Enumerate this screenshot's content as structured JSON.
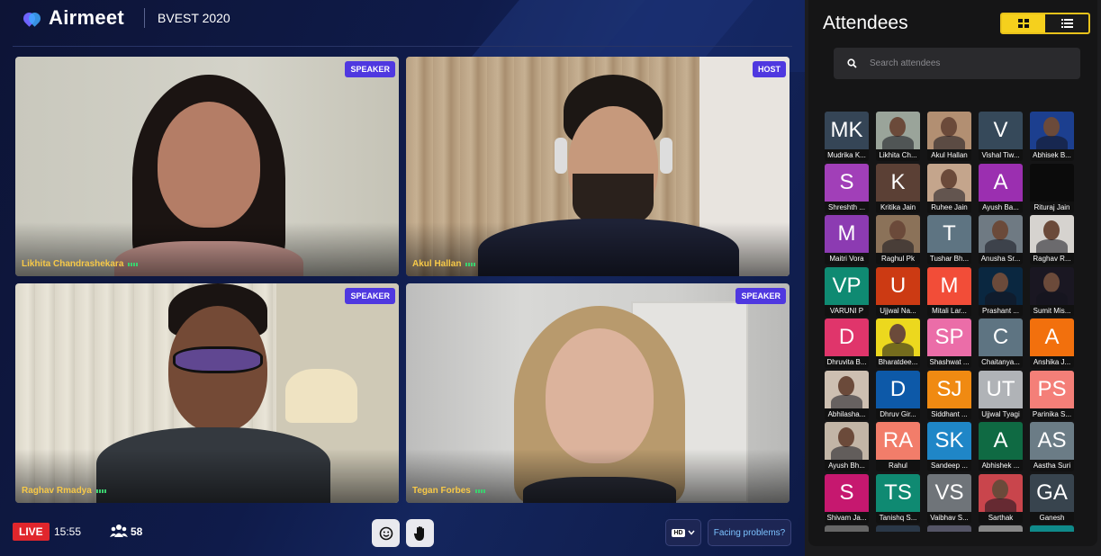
{
  "app": {
    "name": "Airmeet",
    "event": "BVEST 2020"
  },
  "speakers": [
    {
      "name": "Likhita Chandrashekara",
      "role": "SPEAKER"
    },
    {
      "name": "Akul Hallan",
      "role": "HOST"
    },
    {
      "name": "Raghav Rmadya",
      "role": "SPEAKER"
    },
    {
      "name": "Tegan Forbes",
      "role": "SPEAKER"
    }
  ],
  "bottom_bar": {
    "live_label": "LIVE",
    "time": "15:55",
    "participant_count": "58",
    "quality_label": "HD",
    "problems_label": "Facing problems?"
  },
  "attendees_panel": {
    "title": "Attendees",
    "search_placeholder": "Search attendees",
    "attendees": [
      {
        "initials": "MK",
        "name": "Mudrika K...",
        "color": "#354556",
        "photo": false
      },
      {
        "initials": "",
        "name": "Likhita Ch...",
        "color": "#9aa49a",
        "photo": true
      },
      {
        "initials": "",
        "name": "Akul Hallan",
        "color": "#b28f72",
        "photo": true
      },
      {
        "initials": "V",
        "name": "Vishal Tiw...",
        "color": "#36495a",
        "photo": false
      },
      {
        "initials": "",
        "name": "Abhisek B...",
        "color": "#1c3f8f",
        "photo": true
      },
      {
        "initials": "S",
        "name": "Shreshth ...",
        "color": "#a13fb8",
        "photo": false
      },
      {
        "initials": "K",
        "name": "Kritika Jain",
        "color": "#5b4035",
        "photo": false
      },
      {
        "initials": "",
        "name": "Ruhee Jain",
        "color": "#c4a58c",
        "photo": true
      },
      {
        "initials": "A",
        "name": "Ayush Ba...",
        "color": "#9b2fb0",
        "photo": false
      },
      {
        "initials": "",
        "name": "Rituraj Jain",
        "color": "#0b0b0b",
        "photo": false
      },
      {
        "initials": "M",
        "name": "Maitri Vora",
        "color": "#8c3bb2",
        "photo": false
      },
      {
        "initials": "",
        "name": "Raghul Pk",
        "color": "#8b7259",
        "photo": true
      },
      {
        "initials": "T",
        "name": "Tushar Bh...",
        "color": "#5e7482",
        "photo": false
      },
      {
        "initials": "",
        "name": "Anusha Sr...",
        "color": "#6f7a83",
        "photo": true
      },
      {
        "initials": "",
        "name": "Raghav R...",
        "color": "#d6d3cf",
        "photo": true
      },
      {
        "initials": "VP",
        "name": "VARUNI P",
        "color": "#0f8a72",
        "photo": false
      },
      {
        "initials": "U",
        "name": "Ujjwal Na...",
        "color": "#cc3a13",
        "photo": false
      },
      {
        "initials": "M",
        "name": "Mitali Lar...",
        "color": "#f24d38",
        "photo": false
      },
      {
        "initials": "",
        "name": "Prashant ...",
        "color": "#0a2740",
        "photo": true
      },
      {
        "initials": "",
        "name": "Sumit Mis...",
        "color": "#1a1722",
        "photo": true
      },
      {
        "initials": "D",
        "name": "Dhruvita B...",
        "color": "#e0356b",
        "photo": false
      },
      {
        "initials": "",
        "name": "Bharatdee...",
        "color": "#ecd81e",
        "photo": true
      },
      {
        "initials": "SP",
        "name": "Shashwat ...",
        "color": "#eb6da8",
        "photo": false
      },
      {
        "initials": "C",
        "name": "Chaitanya...",
        "color": "#5e7482",
        "photo": false
      },
      {
        "initials": "A",
        "name": "Anshika J...",
        "color": "#f2700d",
        "photo": false
      },
      {
        "initials": "",
        "name": "Abhilasha...",
        "color": "#cdbfb1",
        "photo": true
      },
      {
        "initials": "D",
        "name": "Dhruv Gir...",
        "color": "#0d59a8",
        "photo": false
      },
      {
        "initials": "SJ",
        "name": "Siddhant ...",
        "color": "#f08a12",
        "photo": false
      },
      {
        "initials": "UT",
        "name": "Ujjwal Tyagi",
        "color": "#b0b3b7",
        "photo": false
      },
      {
        "initials": "PS",
        "name": "Parinika S...",
        "color": "#f47f78",
        "photo": false
      },
      {
        "initials": "",
        "name": "Ayush Bh...",
        "color": "#c2b5a6",
        "photo": true
      },
      {
        "initials": "RA",
        "name": "Rahul",
        "color": "#f27d6a",
        "photo": false
      },
      {
        "initials": "SK",
        "name": "Sandeep ...",
        "color": "#1f86c7",
        "photo": false
      },
      {
        "initials": "A",
        "name": "Abhishek ...",
        "color": "#0f6a43",
        "photo": false
      },
      {
        "initials": "AS",
        "name": "Aastha Suri",
        "color": "#6b7c86",
        "photo": false
      },
      {
        "initials": "S",
        "name": "Shivam Ja...",
        "color": "#c6186f",
        "photo": false
      },
      {
        "initials": "TS",
        "name": "Tanishq S...",
        "color": "#0f8a72",
        "photo": false
      },
      {
        "initials": "VS",
        "name": "Vaibhav S...",
        "color": "#6f7479",
        "photo": false
      },
      {
        "initials": "",
        "name": "Sarthak",
        "color": "#c9454c",
        "photo": true
      },
      {
        "initials": "GA",
        "name": "Ganesh",
        "color": "#38444e",
        "photo": false
      },
      {
        "initials": "",
        "name": "",
        "color": "#666",
        "photo": false
      },
      {
        "initials": "",
        "name": "",
        "color": "#2a3848",
        "photo": false
      },
      {
        "initials": "",
        "name": "",
        "color": "#556",
        "photo": false
      },
      {
        "initials": "",
        "name": "",
        "color": "#888",
        "photo": false
      },
      {
        "initials": "",
        "name": "",
        "color": "#0f8a8a",
        "photo": false
      }
    ]
  }
}
